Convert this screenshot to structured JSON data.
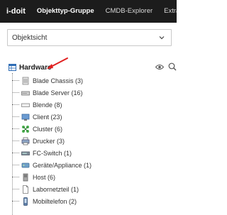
{
  "topbar": {
    "logo": "i-doit",
    "tabs": [
      {
        "label": "Objekttyp-Gruppe",
        "active": true
      },
      {
        "label": "CMDB-Explorer",
        "active": false
      },
      {
        "label": "Extras",
        "active": false
      }
    ]
  },
  "view_select": {
    "value": "Objektsicht"
  },
  "tree": {
    "root_label": "Hardware",
    "items": [
      {
        "label": "Blade Chassis (3)",
        "icon": "blade-chassis-icon"
      },
      {
        "label": "Blade Server (16)",
        "icon": "blade-server-icon"
      },
      {
        "label": "Blende (8)",
        "icon": "blende-icon"
      },
      {
        "label": "Client (23)",
        "icon": "client-icon"
      },
      {
        "label": "Cluster (6)",
        "icon": "cluster-icon"
      },
      {
        "label": "Drucker (3)",
        "icon": "printer-icon"
      },
      {
        "label": "FC-Switch (1)",
        "icon": "fc-switch-icon"
      },
      {
        "label": "Geräte/Appliance (1)",
        "icon": "appliance-icon"
      },
      {
        "label": "Host (6)",
        "icon": "host-icon"
      },
      {
        "label": "Labornetzteil (1)",
        "icon": "power-supply-icon"
      },
      {
        "label": "Mobiltelefon (2)",
        "icon": "mobile-phone-icon"
      }
    ]
  },
  "colors": {
    "topbar_bg": "#1c1c1c",
    "annotation_arrow": "#e02020",
    "tree_root_icon": "#2f6db5"
  }
}
